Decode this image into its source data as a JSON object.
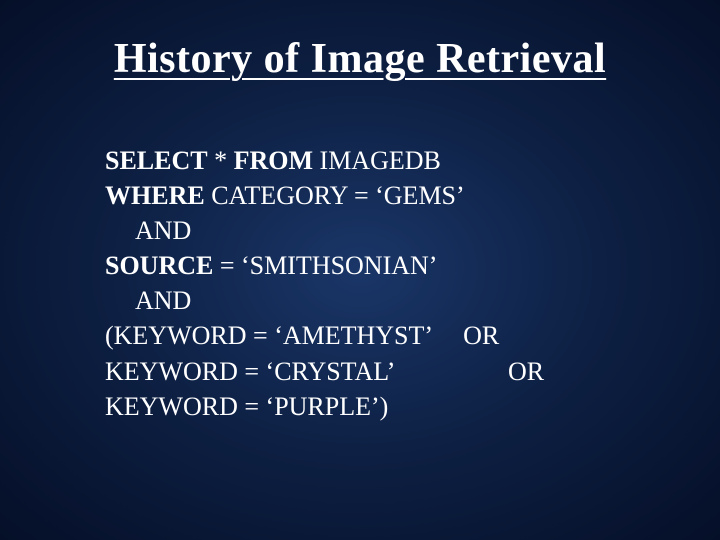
{
  "title": "History of Image Retrieval",
  "query": {
    "line1_pre": "SELECT",
    "line1_mid": " * ",
    "line1_post": "FROM",
    "line1_end": " IMAGEDB",
    "line2_pre": "WHERE",
    "line2_end": " CATEGORY = ‘GEMS’",
    "line3": "AND",
    "line4_pre": "SOURCE",
    "line4_end": " = ‘SMITHSONIAN’",
    "line5": "AND",
    "line6_main": "(KEYWORD = ‘AMETHYST’",
    "line6_op": "OR",
    "line7_main": "KEYWORD = ‘CRYSTAL’",
    "line7_op": "OR",
    "line8_main": "KEYWORD = ‘PURPLE’)"
  }
}
